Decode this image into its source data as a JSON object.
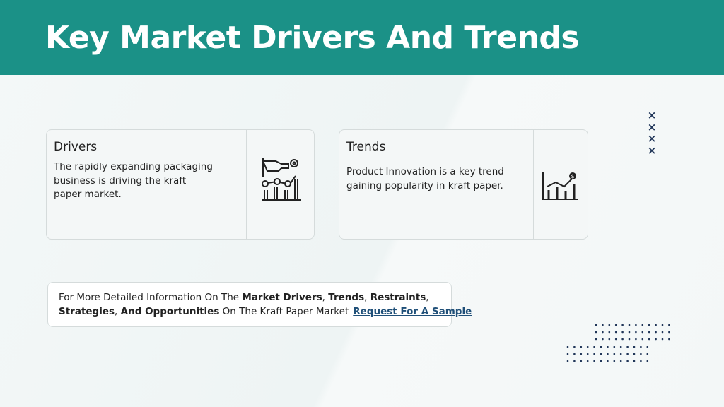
{
  "header": {
    "title": "Key Market Drivers And Trends"
  },
  "drivers_card": {
    "title": "Drivers",
    "lines": [
      "The rapidly expanding packaging",
      "business is driving the kraft",
      "paper market."
    ],
    "icon": "growth-hand-chart-icon"
  },
  "trends_card": {
    "title": "Trends",
    "lines": [
      "Product Innovation is a key trend",
      "gaining popularity in kraft paper."
    ],
    "icon": "dollar-trend-chart-icon"
  },
  "decor": {
    "x_marks": [
      "×",
      "×",
      "×",
      "×"
    ]
  },
  "info_box": {
    "t1": "For More Detailed Information On The ",
    "b1": "Market Drivers",
    "t2": ", ",
    "b2": "Trends",
    "t3": ", ",
    "b3": "Restraints",
    "t4": ",",
    "b4": "Strategies",
    "t5": ", ",
    "b5": "And Opportunities",
    "t6": " On The Kraft Paper Market",
    "link": "Request For A Sample"
  },
  "colors": {
    "header": "#1b9187",
    "link": "#1f4f78",
    "x_marks": "#1f3558",
    "dots": "#1f3558"
  }
}
